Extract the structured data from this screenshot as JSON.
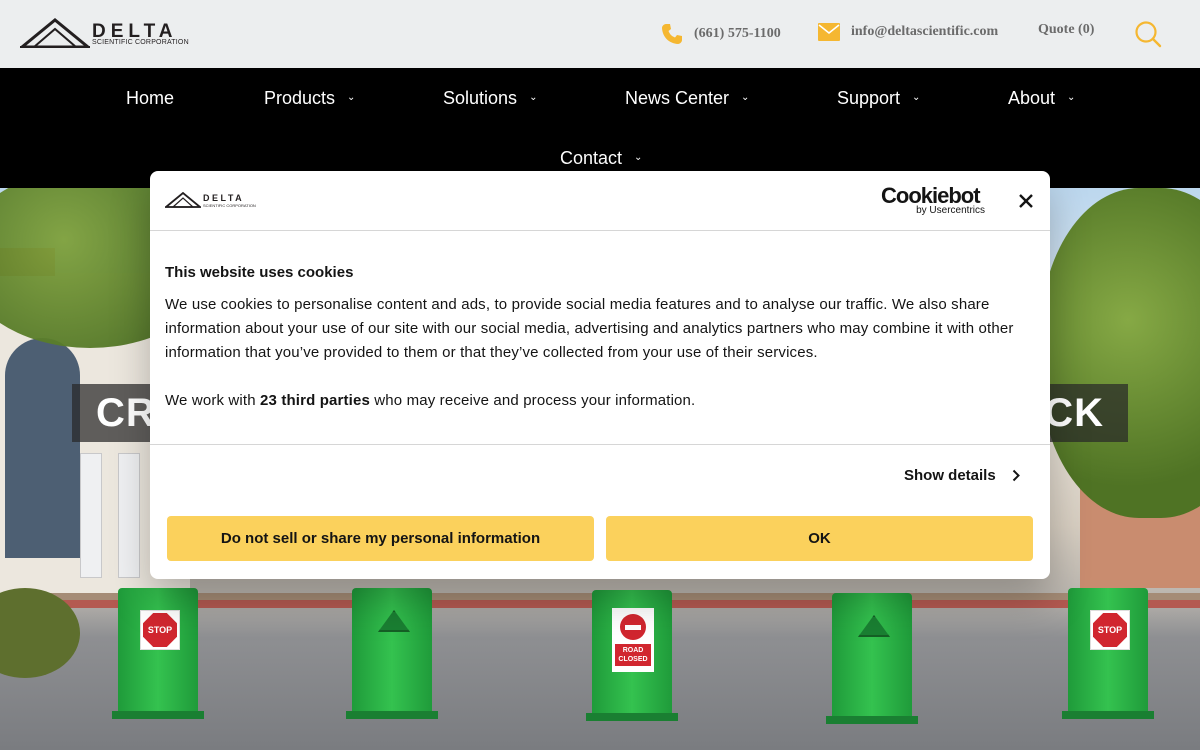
{
  "header": {
    "logo_word": "DELTA",
    "logo_sub": "SCIENTIFIC CORPORATION",
    "phone": "(661) 575-1100",
    "email": "info@deltascientific.com",
    "quote": "Quote (0)",
    "icons": [
      "phone-icon",
      "mail-icon",
      "search-icon"
    ],
    "accent_color": "#f5b731"
  },
  "nav": {
    "items": [
      {
        "label": "Home",
        "has_dropdown": false
      },
      {
        "label": "Products",
        "has_dropdown": true
      },
      {
        "label": "Solutions",
        "has_dropdown": true
      },
      {
        "label": "News Center",
        "has_dropdown": true
      },
      {
        "label": "Support",
        "has_dropdown": true
      },
      {
        "label": "About",
        "has_dropdown": true
      },
      {
        "label": "Contact",
        "has_dropdown": true
      }
    ]
  },
  "hero": {
    "title_left": "CR",
    "title_right": "CK",
    "barriers": [
      {
        "sign": "STOP"
      },
      {
        "sign": "logo"
      },
      {
        "sign": "ROAD CLOSED"
      },
      {
        "sign": "logo"
      },
      {
        "sign": "STOP"
      }
    ]
  },
  "cookie": {
    "brand_word": "DELTA",
    "brand_sub": "SCIENTIFIC CORPORATION",
    "provider": "Cookiebot",
    "provider_by": "by Usercentrics",
    "title": "This website uses cookies",
    "body": "We use cookies to personalise content and ads, to provide social media features and to analyse our traffic. We also share information about your use of our site with our social media, advertising and analytics partners who may combine it with other information that you’ve provided to them or that they’ve collected from your use of their services.",
    "third_prefix": "We work with ",
    "third_bold": "23 third parties",
    "third_suffix": " who may receive and process your information.",
    "show_details": "Show details",
    "btn_decline": "Do not sell or share my personal information",
    "btn_ok": "OK",
    "button_color": "#fbd15c"
  }
}
